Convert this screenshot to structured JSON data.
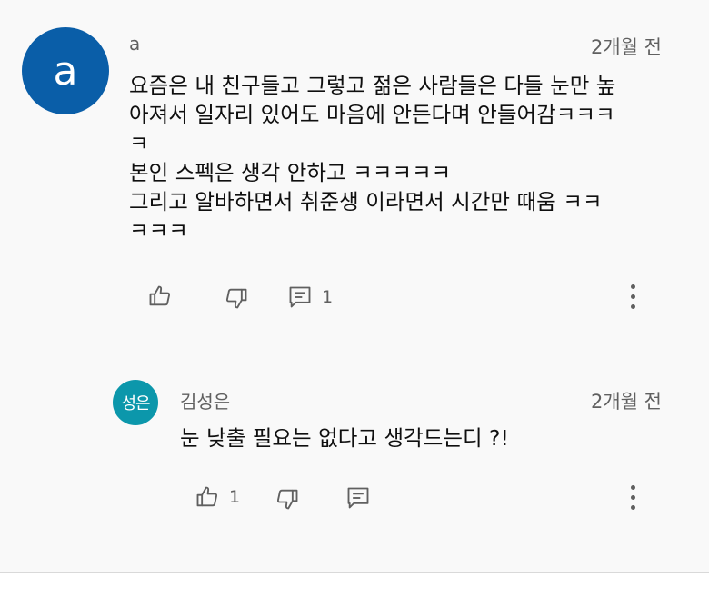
{
  "comment": {
    "avatar_letter": "a",
    "avatar_color": "#0a5ea8",
    "author": "a",
    "time": "2개월 전",
    "text": "요즘은 내 친구들고 그렇고 젊은 사람들은 다들 눈만 높\n아져서 일자리 있어도 마음에 안든다며 안들어감ㅋㅋㅋ\nㅋ\n본인 스펙은 생각 안하고 ㅋㅋㅋㅋㅋ\n그리고 알바하면서 취준생 이라면서 시간만 때움 ㅋㅋ\nㅋㅋㅋ",
    "reply_count": "1",
    "icons": {
      "like": "thumbs-up-icon",
      "dislike": "thumbs-down-icon",
      "reply": "comment-icon",
      "more": "more-vertical-icon"
    }
  },
  "reply": {
    "avatar_text": "성은",
    "avatar_color": "#0c97ab",
    "author": "김성은",
    "time": "2개월 전",
    "text": "눈 낮출 필요는 없다고 생각드는디 ?!",
    "like_count": "1"
  }
}
